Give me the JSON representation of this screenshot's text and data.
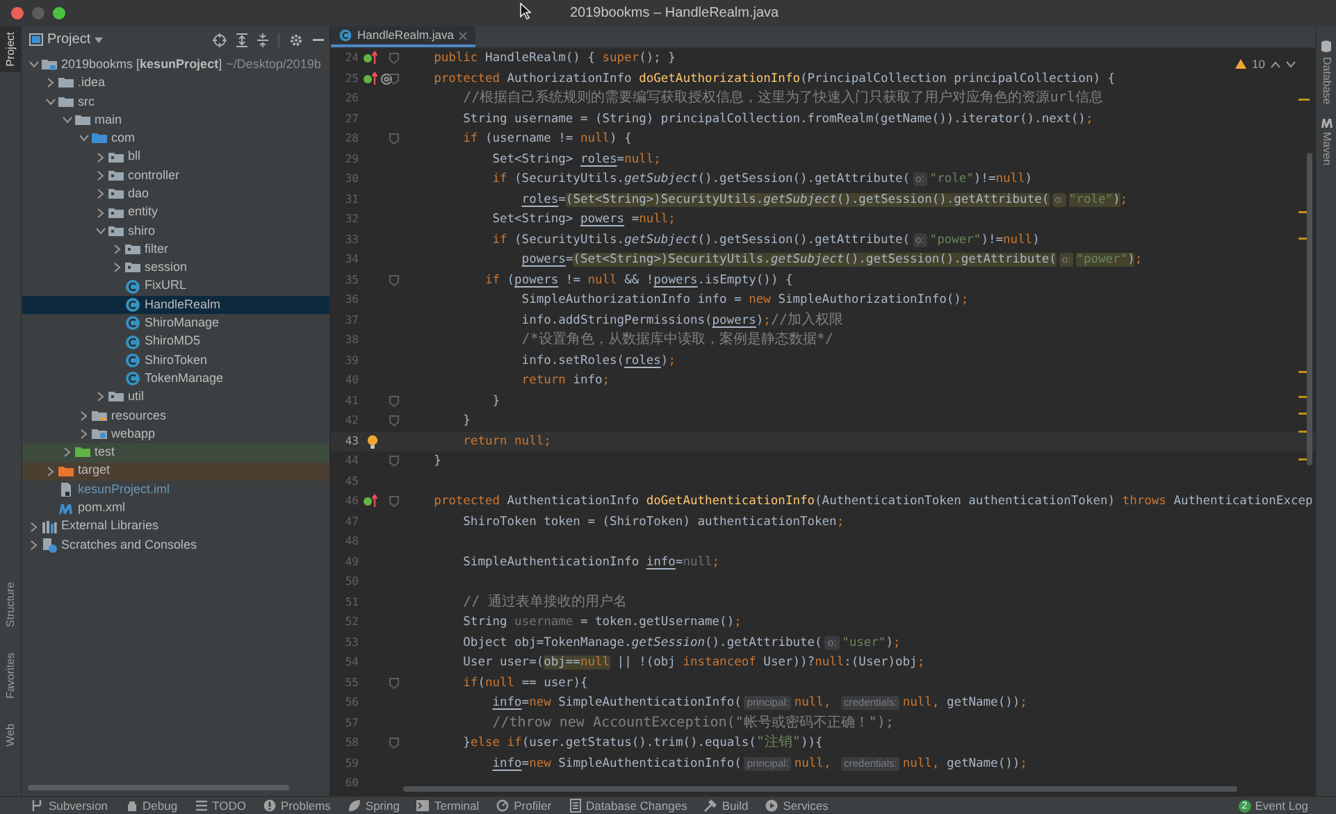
{
  "window": {
    "title": "2019bookms – HandleRealm.java"
  },
  "left_stripe": [
    {
      "label": "Project",
      "selected": true
    },
    {
      "label": "Structure",
      "selected": false
    },
    {
      "label": "Favorites",
      "selected": false
    },
    {
      "label": "Web",
      "selected": false
    }
  ],
  "project": {
    "title": "Project",
    "items": [
      {
        "label": "2019bookms [**kesunProject**]",
        "path": "~/Desktop/2019b",
        "kind": "module",
        "expanded": true,
        "selected": false,
        "children": [
          {
            "label": ".idea",
            "kind": "folder",
            "expanded": false,
            "selected": false
          },
          {
            "label": "src",
            "kind": "folder",
            "expanded": true,
            "selected": false,
            "children": [
              {
                "label": "main",
                "kind": "folder",
                "expanded": true,
                "selected": false,
                "children": [
                  {
                    "label": "com",
                    "kind": "source-folder",
                    "expanded": true,
                    "selected": false,
                    "children": [
                      {
                        "label": "bll",
                        "kind": "package",
                        "expanded": false,
                        "selected": false
                      },
                      {
                        "label": "controller",
                        "kind": "package",
                        "expanded": false,
                        "selected": false
                      },
                      {
                        "label": "dao",
                        "kind": "package",
                        "expanded": false,
                        "selected": false
                      },
                      {
                        "label": "entity",
                        "kind": "package",
                        "expanded": false,
                        "selected": false
                      },
                      {
                        "label": "shiro",
                        "kind": "package",
                        "expanded": true,
                        "selected": false,
                        "children": [
                          {
                            "label": "filter",
                            "kind": "package",
                            "expanded": false,
                            "selected": false
                          },
                          {
                            "label": "session",
                            "kind": "package",
                            "expanded": false,
                            "selected": false
                          },
                          {
                            "label": "FixURL",
                            "kind": "class",
                            "selected": false
                          },
                          {
                            "label": "HandleRealm",
                            "kind": "class",
                            "selected": true
                          },
                          {
                            "label": "ShiroManage",
                            "kind": "class",
                            "selected": false
                          },
                          {
                            "label": "ShiroMD5",
                            "kind": "class",
                            "selected": false
                          },
                          {
                            "label": "ShiroToken",
                            "kind": "class",
                            "selected": false
                          },
                          {
                            "label": "TokenManage",
                            "kind": "class",
                            "selected": false
                          }
                        ]
                      },
                      {
                        "label": "util",
                        "kind": "package",
                        "expanded": false,
                        "selected": false
                      }
                    ]
                  },
                  {
                    "label": "resources",
                    "kind": "resources-folder",
                    "expanded": false,
                    "selected": false
                  },
                  {
                    "label": "webapp",
                    "kind": "web-folder",
                    "expanded": false,
                    "selected": false
                  }
                ]
              },
              {
                "label": "test",
                "kind": "test-folder",
                "expanded": false,
                "selected": false
              }
            ]
          },
          {
            "label": "target",
            "kind": "excluded-folder",
            "expanded": false,
            "selected": false
          },
          {
            "label": "kesunProject.iml",
            "kind": "iml",
            "selected": false
          },
          {
            "label": "pom.xml",
            "kind": "pom",
            "selected": false
          }
        ]
      },
      {
        "label": "External Libraries",
        "kind": "libraries",
        "expanded": false,
        "selected": false
      },
      {
        "label": "Scratches and Consoles",
        "kind": "scratches",
        "expanded": false,
        "selected": false
      }
    ]
  },
  "editor": {
    "tabs": [
      {
        "label": "HandleRealm.java",
        "selected": true
      }
    ],
    "warning_count": "10",
    "lines": [
      {
        "number": "24",
        "kind": "override",
        "current": false,
        "fold": true,
        "tokens": [
          {
            "kind": "k",
            "text": "    public"
          },
          {
            "kind": "t",
            "text": " HandleRealm() { "
          },
          {
            "kind": "k",
            "text": "super"
          },
          {
            "kind": "t",
            "text": "(); }"
          }
        ]
      },
      {
        "number": "25",
        "kind": "override-at",
        "current": false,
        "fold": true,
        "tokens": [
          {
            "kind": "k",
            "text": "    protected "
          },
          {
            "kind": "t",
            "text": "AuthorizationInfo "
          },
          {
            "kind": "f",
            "text": "doGetAuthorizationInfo"
          },
          {
            "kind": "t",
            "text": "(PrincipalCollection principalCollection) {"
          }
        ]
      },
      {
        "number": "26",
        "kind": "plain",
        "current": false,
        "fold": false,
        "tokens": [
          {
            "kind": "cc",
            "text": "        //根据自己系统规则的需要编写获取授权信息，这里为了快速入门只获取了用户对应角色的资源url信息"
          }
        ]
      },
      {
        "number": "27",
        "kind": "plain",
        "current": false,
        "fold": false,
        "tokens": [
          {
            "kind": "t",
            "text": "        String username = (String) principalCollection.fromRealm(getName()).iterator().next()"
          },
          {
            "kind": "k",
            "text": ";"
          }
        ]
      },
      {
        "number": "28",
        "kind": "plain",
        "current": false,
        "fold": true,
        "tokens": [
          {
            "kind": "k",
            "text": "        if "
          },
          {
            "kind": "t",
            "text": "(username != "
          },
          {
            "kind": "k",
            "text": "null"
          },
          {
            "kind": "t",
            "text": ") {"
          }
        ]
      },
      {
        "number": "29",
        "kind": "plain",
        "current": false,
        "fold": false,
        "tokens": [
          {
            "kind": "t",
            "text": "            Set<String> "
          },
          {
            "kind": "u",
            "text": "roles"
          },
          {
            "kind": "t",
            "text": "="
          },
          {
            "kind": "k",
            "text": "null;"
          }
        ]
      },
      {
        "number": "30",
        "kind": "plain",
        "current": false,
        "fold": false,
        "tokens": [
          {
            "kind": "k",
            "text": "            if "
          },
          {
            "kind": "t",
            "text": "(SecurityUtils."
          },
          {
            "kind": "i",
            "text": "getSubject"
          },
          {
            "kind": "t",
            "text": "().getSession().getAttribute("
          },
          {
            "kind": "h",
            "text": "o:"
          },
          {
            "kind": "s",
            "text": "\"role\""
          },
          {
            "kind": "t",
            "text": ")!="
          },
          {
            "kind": "k",
            "text": "null"
          },
          {
            "kind": "t",
            "text": ")"
          }
        ]
      },
      {
        "number": "31",
        "kind": "plain",
        "current": false,
        "fold": false,
        "tokens": [
          {
            "kind": "u",
            "text": "                roles"
          },
          {
            "kind": "t",
            "text": "="
          },
          {
            "kind": "ht",
            "text": "(Set<String>)SecurityUtils."
          },
          {
            "kind": "hi",
            "text": "getSubject"
          },
          {
            "kind": "ht",
            "text": "().getSession().getAttribute("
          },
          {
            "kind": "hh",
            "text": "o:"
          },
          {
            "kind": "hs",
            "text": "\"role\""
          },
          {
            "kind": "ht",
            "text": ")"
          },
          {
            "kind": "k",
            "text": ";"
          }
        ]
      },
      {
        "number": "32",
        "kind": "plain",
        "current": false,
        "fold": false,
        "tokens": [
          {
            "kind": "t",
            "text": "            Set<String> "
          },
          {
            "kind": "u",
            "text": "powers"
          },
          {
            "kind": "t",
            "text": " ="
          },
          {
            "kind": "k",
            "text": "null;"
          }
        ]
      },
      {
        "number": "33",
        "kind": "plain",
        "current": false,
        "fold": false,
        "tokens": [
          {
            "kind": "k",
            "text": "            if "
          },
          {
            "kind": "t",
            "text": "(SecurityUtils."
          },
          {
            "kind": "i",
            "text": "getSubject"
          },
          {
            "kind": "t",
            "text": "().getSession().getAttribute("
          },
          {
            "kind": "h",
            "text": "o:"
          },
          {
            "kind": "s",
            "text": "\"power\""
          },
          {
            "kind": "t",
            "text": ")!="
          },
          {
            "kind": "k",
            "text": "null"
          },
          {
            "kind": "t",
            "text": ")"
          }
        ]
      },
      {
        "number": "34",
        "kind": "plain",
        "current": false,
        "fold": false,
        "tokens": [
          {
            "kind": "u",
            "text": "                powers"
          },
          {
            "kind": "t",
            "text": "="
          },
          {
            "kind": "ht",
            "text": "(Set<String>)SecurityUtils."
          },
          {
            "kind": "hi",
            "text": "getSubject"
          },
          {
            "kind": "ht",
            "text": "().getSession().getAttribute("
          },
          {
            "kind": "hh",
            "text": "o:"
          },
          {
            "kind": "hs",
            "text": "\"power\""
          },
          {
            "kind": "ht",
            "text": ")"
          },
          {
            "kind": "k",
            "text": ";"
          }
        ]
      },
      {
        "number": "35",
        "kind": "plain",
        "current": false,
        "fold": true,
        "tokens": [
          {
            "kind": "k",
            "text": "           if "
          },
          {
            "kind": "t",
            "text": "("
          },
          {
            "kind": "u",
            "text": "powers"
          },
          {
            "kind": "t",
            "text": " != "
          },
          {
            "kind": "k",
            "text": "null "
          },
          {
            "kind": "t",
            "text": "&& !"
          },
          {
            "kind": "u",
            "text": "powers"
          },
          {
            "kind": "t",
            "text": ".isEmpty()) {"
          }
        ]
      },
      {
        "number": "36",
        "kind": "plain",
        "current": false,
        "fold": false,
        "tokens": [
          {
            "kind": "t",
            "text": "                SimpleAuthorizationInfo info = "
          },
          {
            "kind": "k",
            "text": "new "
          },
          {
            "kind": "t",
            "text": "SimpleAuthorizationInfo()"
          },
          {
            "kind": "k",
            "text": ";"
          }
        ]
      },
      {
        "number": "37",
        "kind": "plain",
        "current": false,
        "fold": false,
        "tokens": [
          {
            "kind": "t",
            "text": "                info.addStringPermissions("
          },
          {
            "kind": "u",
            "text": "powers"
          },
          {
            "kind": "t",
            "text": ")"
          },
          {
            "kind": "k",
            "text": ";"
          },
          {
            "kind": "cc",
            "text": "//加入权限"
          }
        ]
      },
      {
        "number": "38",
        "kind": "plain",
        "current": false,
        "fold": false,
        "tokens": [
          {
            "kind": "cc",
            "text": "                /*设置角色，从数据库中读取，案例是静态数据*/"
          }
        ]
      },
      {
        "number": "39",
        "kind": "plain",
        "current": false,
        "fold": false,
        "tokens": [
          {
            "kind": "t",
            "text": "                info.setRoles("
          },
          {
            "kind": "u",
            "text": "roles"
          },
          {
            "kind": "t",
            "text": ")"
          },
          {
            "kind": "k",
            "text": ";"
          }
        ]
      },
      {
        "number": "40",
        "kind": "plain",
        "current": false,
        "fold": false,
        "tokens": [
          {
            "kind": "k",
            "text": "                return "
          },
          {
            "kind": "t",
            "text": "info"
          },
          {
            "kind": "k",
            "text": ";"
          }
        ]
      },
      {
        "number": "41",
        "kind": "plain",
        "current": false,
        "fold": true,
        "tokens": [
          {
            "kind": "t",
            "text": "            }"
          }
        ]
      },
      {
        "number": "42",
        "kind": "plain",
        "current": false,
        "fold": true,
        "tokens": [
          {
            "kind": "t",
            "text": "        }"
          }
        ]
      },
      {
        "number": "43",
        "kind": "bulb",
        "current": true,
        "fold": false,
        "tokens": [
          {
            "kind": "k",
            "text": "        return null;"
          }
        ]
      },
      {
        "number": "44",
        "kind": "plain",
        "current": false,
        "fold": true,
        "tokens": [
          {
            "kind": "t",
            "text": "    }"
          }
        ]
      },
      {
        "number": "45",
        "kind": "plain",
        "current": false,
        "fold": false
      },
      {
        "number": "46",
        "kind": "override",
        "current": false,
        "fold": true,
        "tokens": [
          {
            "kind": "k",
            "text": "    protected "
          },
          {
            "kind": "t",
            "text": "AuthenticationInfo "
          },
          {
            "kind": "f",
            "text": "doGetAuthenticationInfo"
          },
          {
            "kind": "t",
            "text": "(AuthenticationToken authenticationToken) "
          },
          {
            "kind": "k",
            "text": "throws "
          },
          {
            "kind": "t",
            "text": "AuthenticationExcep"
          }
        ]
      },
      {
        "number": "47",
        "kind": "plain",
        "current": false,
        "fold": false,
        "tokens": [
          {
            "kind": "t",
            "text": "        ShiroToken token = (ShiroToken) authenticationToken"
          },
          {
            "kind": "k",
            "text": ";"
          }
        ]
      },
      {
        "number": "48",
        "kind": "plain",
        "current": false,
        "fold": false
      },
      {
        "number": "49",
        "kind": "plain",
        "current": false,
        "fold": false,
        "tokens": [
          {
            "kind": "t",
            "text": "        SimpleAuthenticationInfo "
          },
          {
            "kind": "u",
            "text": "info"
          },
          {
            "kind": "t",
            "text": "="
          },
          {
            "kind": "d",
            "text": "null"
          },
          {
            "kind": "k",
            "text": ";"
          }
        ]
      },
      {
        "number": "50",
        "kind": "plain",
        "current": false,
        "fold": false
      },
      {
        "number": "51",
        "kind": "plain",
        "current": false,
        "fold": false,
        "tokens": [
          {
            "kind": "cc",
            "text": "        // 通过表单接收的用户名"
          }
        ]
      },
      {
        "number": "52",
        "kind": "plain",
        "current": false,
        "fold": false,
        "tokens": [
          {
            "kind": "t",
            "text": "        String "
          },
          {
            "kind": "d",
            "text": "username"
          },
          {
            "kind": "t",
            "text": " = token.getUsername()"
          },
          {
            "kind": "k",
            "text": ";"
          }
        ]
      },
      {
        "number": "53",
        "kind": "plain",
        "current": false,
        "fold": false,
        "tokens": [
          {
            "kind": "t",
            "text": "        Object obj=TokenManage."
          },
          {
            "kind": "i",
            "text": "getSession"
          },
          {
            "kind": "t",
            "text": "().getAttribute("
          },
          {
            "kind": "h",
            "text": "o:"
          },
          {
            "kind": "s",
            "text": "\"user\""
          },
          {
            "kind": "t",
            "text": ")"
          },
          {
            "kind": "k",
            "text": ";"
          }
        ]
      },
      {
        "number": "54",
        "kind": "plain",
        "current": false,
        "fold": false,
        "tokens": [
          {
            "kind": "t",
            "text": "        User user=("
          },
          {
            "kind": "ht",
            "text": "obj=="
          },
          {
            "kind": "hk",
            "text": "null"
          },
          {
            "kind": "t",
            "text": " || !(obj "
          },
          {
            "kind": "k",
            "text": "instanceof "
          },
          {
            "kind": "t",
            "text": "User))?"
          },
          {
            "kind": "k",
            "text": "null"
          },
          {
            "kind": "t",
            "text": ":(User)obj"
          },
          {
            "kind": "k",
            "text": ";"
          }
        ]
      },
      {
        "number": "55",
        "kind": "plain",
        "current": false,
        "fold": true,
        "tokens": [
          {
            "kind": "k",
            "text": "        if"
          },
          {
            "kind": "t",
            "text": "("
          },
          {
            "kind": "k",
            "text": "null "
          },
          {
            "kind": "t",
            "text": "== user){"
          }
        ]
      },
      {
        "number": "56",
        "kind": "plain",
        "current": false,
        "fold": false,
        "tokens": [
          {
            "kind": "u",
            "text": "            info"
          },
          {
            "kind": "t",
            "text": "="
          },
          {
            "kind": "k",
            "text": "new "
          },
          {
            "kind": "t",
            "text": "SimpleAuthenticationInfo("
          },
          {
            "kind": "h",
            "text": "principal:"
          },
          {
            "kind": "k",
            "text": "null, "
          },
          {
            "kind": "h",
            "text": "credentials:"
          },
          {
            "kind": "k",
            "text": "null, "
          },
          {
            "kind": "t",
            "text": "getName())"
          },
          {
            "kind": "k",
            "text": ";"
          }
        ]
      },
      {
        "number": "57",
        "kind": "plain",
        "current": false,
        "fold": false,
        "tokens": [
          {
            "kind": "cc",
            "text": "            //throw new AccountException(\"帐号或密码不正确！\");"
          }
        ]
      },
      {
        "number": "58",
        "kind": "plain",
        "current": false,
        "fold": true,
        "tokens": [
          {
            "kind": "t",
            "text": "        }"
          },
          {
            "kind": "k",
            "text": "else if"
          },
          {
            "kind": "t",
            "text": "(user.getStatus().trim().equals("
          },
          {
            "kind": "sc",
            "text": "\"注销\""
          },
          {
            "kind": "t",
            "text": ")){"
          }
        ]
      },
      {
        "number": "59",
        "kind": "plain",
        "current": false,
        "fold": false,
        "tokens": [
          {
            "kind": "u",
            "text": "            info"
          },
          {
            "kind": "t",
            "text": "="
          },
          {
            "kind": "k",
            "text": "new "
          },
          {
            "kind": "t",
            "text": "SimpleAuthenticationInfo("
          },
          {
            "kind": "h",
            "text": "principal:"
          },
          {
            "kind": "k",
            "text": "null, "
          },
          {
            "kind": "h",
            "text": "credentials:"
          },
          {
            "kind": "k",
            "text": "null, "
          },
          {
            "kind": "t",
            "text": "getName())"
          },
          {
            "kind": "k",
            "text": ";"
          }
        ]
      },
      {
        "number": "60",
        "kind": "plain",
        "current": false,
        "fold": false
      }
    ]
  },
  "right_stripe": [
    {
      "label": "Database"
    },
    {
      "label": "Maven"
    }
  ],
  "bottom_bar": {
    "tools": [
      "Subversion",
      "Debug",
      "TODO",
      "Problems",
      "Spring",
      "Terminal",
      "Profiler",
      "Database Changes",
      "Build",
      "Services"
    ],
    "event_log": {
      "label": "Event Log",
      "badge": "2"
    }
  }
}
